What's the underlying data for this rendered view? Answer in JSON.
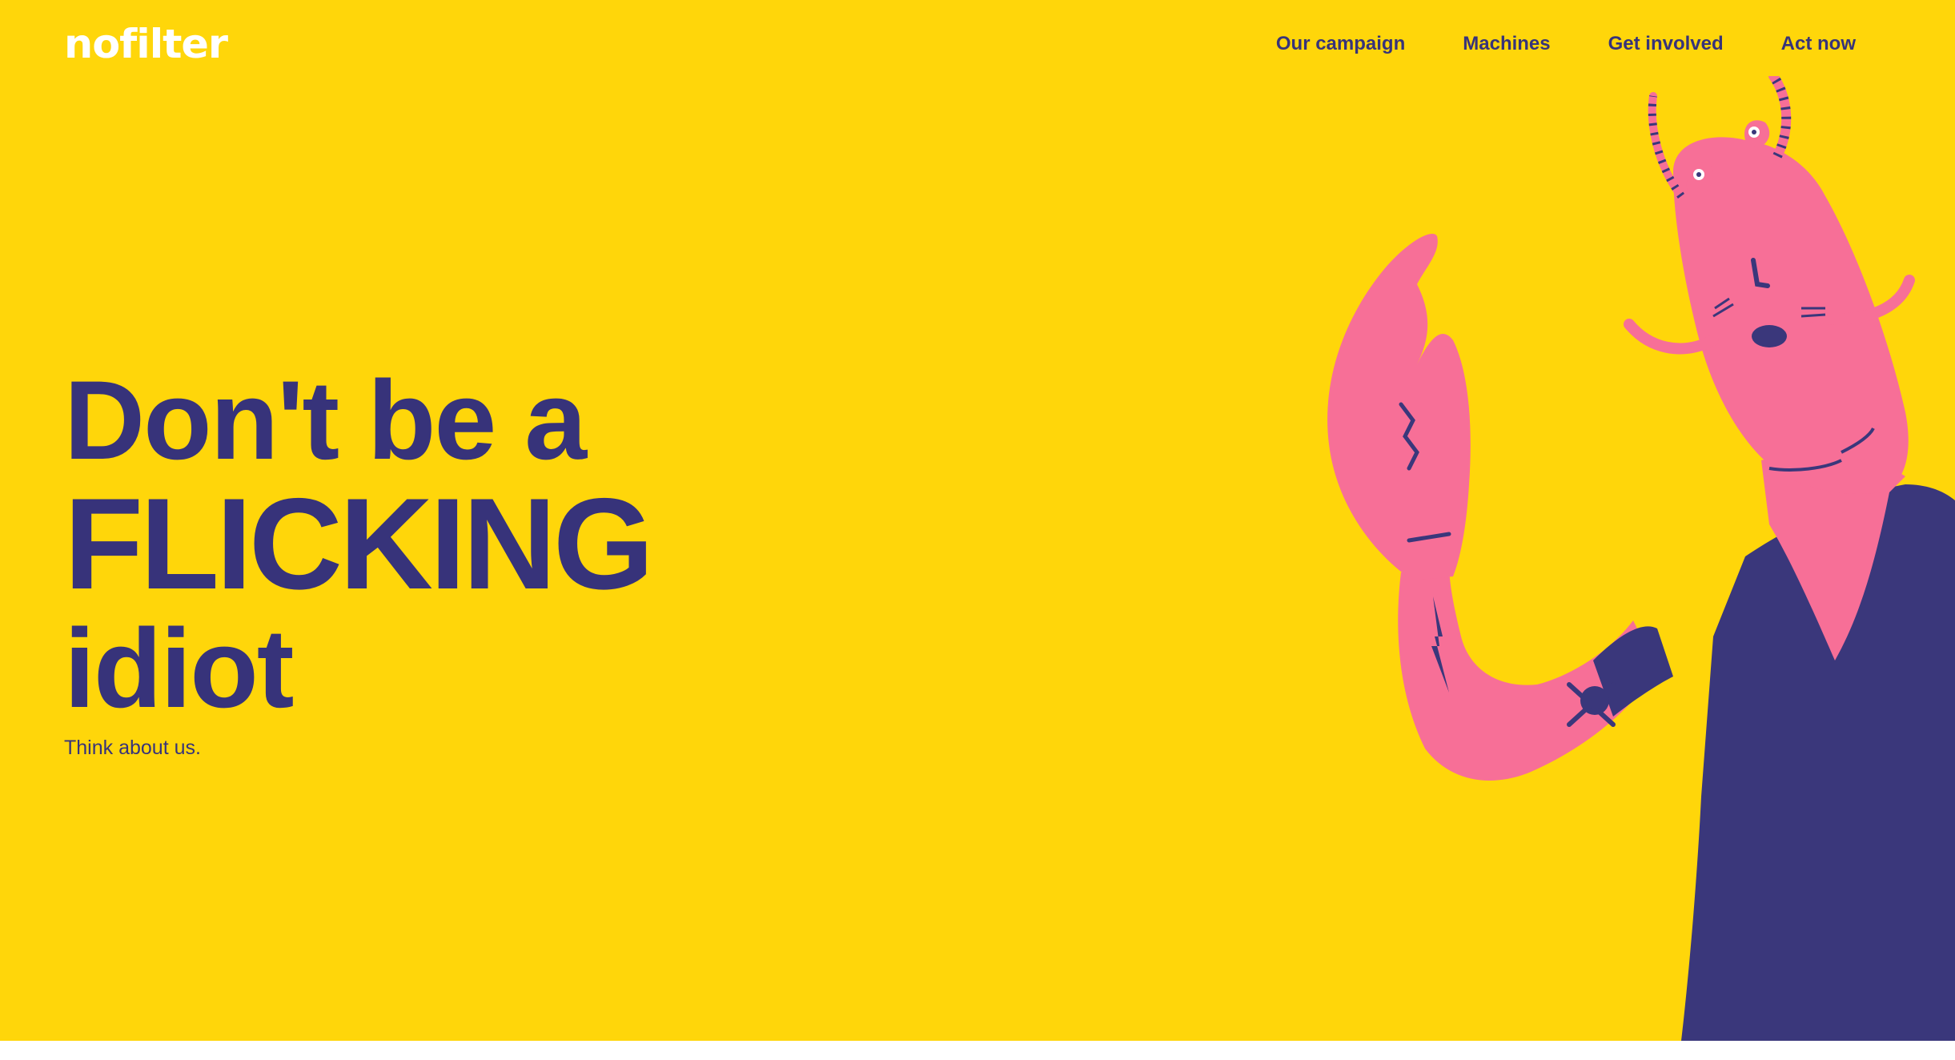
{
  "header": {
    "logo_text": "nofilter",
    "nav": [
      {
        "label": "Our campaign"
      },
      {
        "label": "Machines"
      },
      {
        "label": "Get involved"
      },
      {
        "label": "Act now"
      }
    ]
  },
  "hero": {
    "line1": "Don't be a",
    "line2": "FLICKING",
    "line3": "idiot",
    "subtitle": "Think about us."
  },
  "colors": {
    "background": "#FFD60A",
    "text": "#37337A",
    "lobster": "#F76F97",
    "shirt": "#3A377B",
    "logo": "#FFFFFF"
  },
  "icons": {
    "illustration": "lobster-illustration"
  }
}
